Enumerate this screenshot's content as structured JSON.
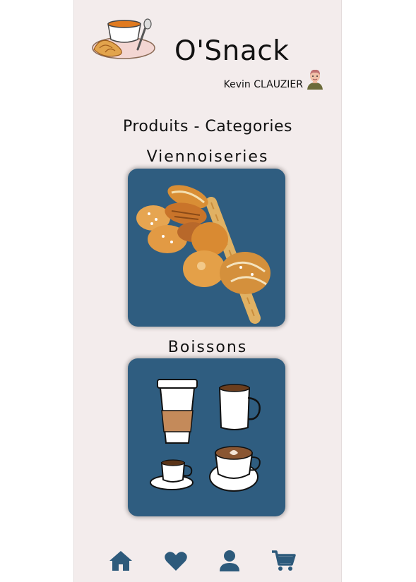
{
  "header": {
    "app_title": "O'Snack",
    "user_name": "Kevin CLAUZIER",
    "logo_icon": "coffee-croissant-logo",
    "avatar_icon": "user-avatar-icon"
  },
  "main": {
    "heading": "Produits - Categories",
    "categories": [
      {
        "label": "Viennoiseries",
        "image_icon": "pastries-image"
      },
      {
        "label": "Boissons",
        "image_icon": "coffee-cups-image"
      }
    ]
  },
  "bottom_nav": {
    "items": [
      {
        "icon": "home-icon"
      },
      {
        "icon": "heart-icon"
      },
      {
        "icon": "user-icon"
      },
      {
        "icon": "cart-icon"
      }
    ]
  },
  "colors": {
    "background": "#f3ecec",
    "card": "#2f5d80",
    "nav_icon": "#2d5a7b"
  }
}
